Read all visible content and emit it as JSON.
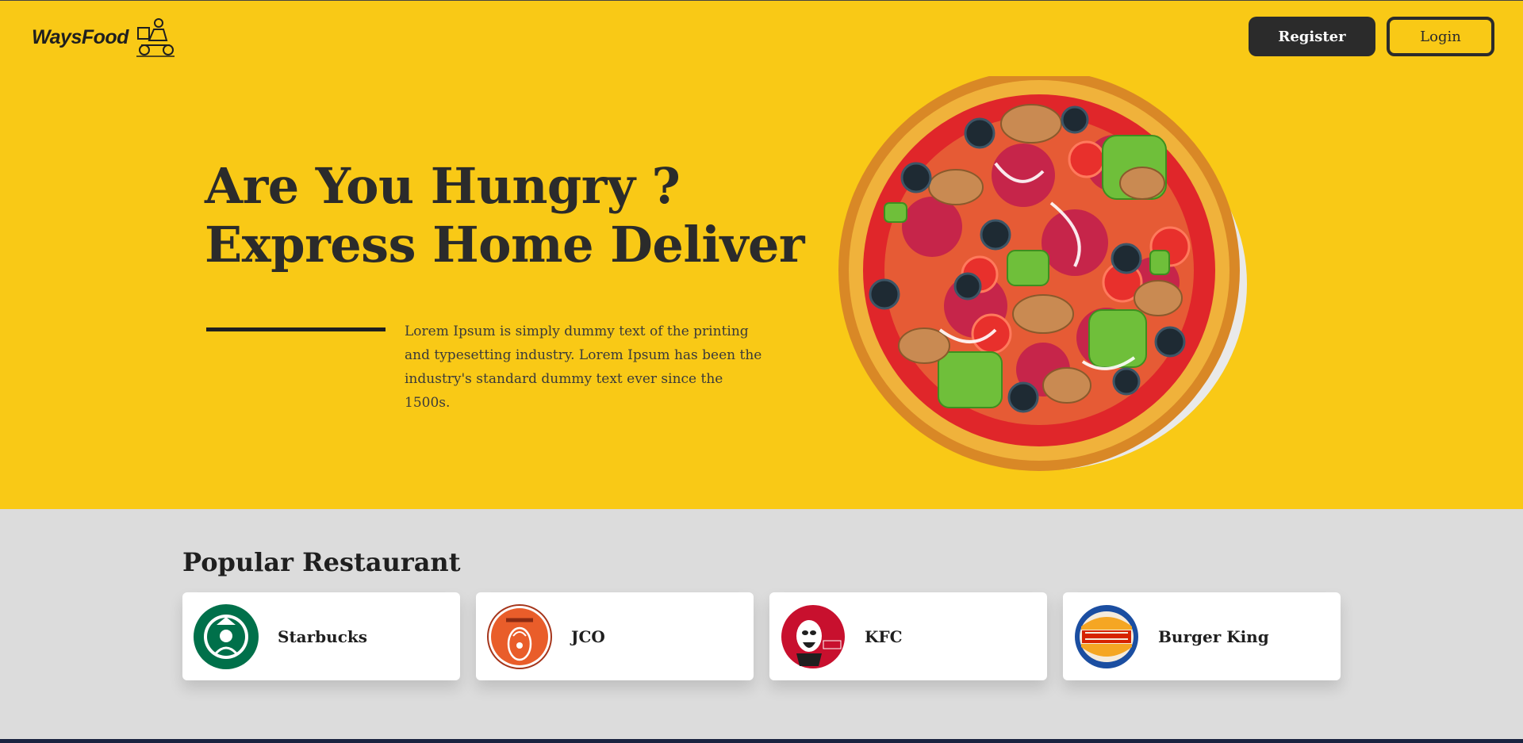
{
  "header": {
    "brand": "WaysFood",
    "brand_icon": "delivery-scooter-icon",
    "register_label": "Register",
    "login_label": "Login"
  },
  "hero": {
    "headline_line1": "Are You Hungry ?",
    "headline_line2": "Express Home Deliver",
    "description": "Lorem Ipsum is simply dummy text of the printing and typesetting industry. Lorem Ipsum has been the industry's standard dummy text ever since the 1500s.",
    "image": "pizza-illustration"
  },
  "popular": {
    "title": "Popular Restaurant",
    "restaurants": [
      {
        "name": "Starbucks",
        "logo": "starbucks-logo"
      },
      {
        "name": "JCO",
        "logo": "jco-logo"
      },
      {
        "name": "KFC",
        "logo": "kfc-logo"
      },
      {
        "name": "Burger King",
        "logo": "burger-king-logo"
      }
    ]
  },
  "colors": {
    "hero_bg": "#f9c916",
    "page_bg": "#dcdcdc",
    "dark": "#2b2b2b",
    "card_bg": "#ffffff"
  }
}
